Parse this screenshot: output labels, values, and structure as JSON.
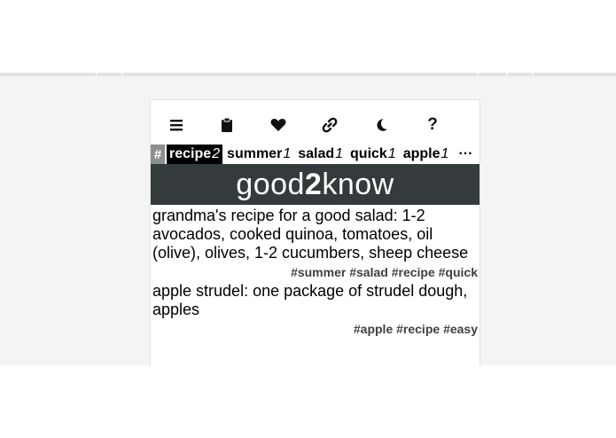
{
  "toolbar": {
    "buttons": [
      {
        "name": "menu-icon"
      },
      {
        "name": "clipboard-icon"
      },
      {
        "name": "heart-icon"
      },
      {
        "name": "link-icon"
      },
      {
        "name": "moon-icon"
      },
      {
        "name": "help-icon",
        "label": "?"
      }
    ]
  },
  "tags": {
    "hash_symbol": "#",
    "items": [
      {
        "label": "recipe",
        "count": "2",
        "active": true
      },
      {
        "label": "summer",
        "count": "1"
      },
      {
        "label": "salad",
        "count": "1"
      },
      {
        "label": "quick",
        "count": "1"
      },
      {
        "label": "apple",
        "count": "1"
      }
    ],
    "more": "···"
  },
  "brand": {
    "part1": "good",
    "part2": "2",
    "part3": "know"
  },
  "notes": [
    {
      "text": "grandma's recipe for a good salad: 1-2 avocados, cooked quinoa, tomatoes, oil (olive), olives, 1-2 cucumbers, sheep cheese",
      "tags": [
        "#summer",
        "#salad",
        "#recipe",
        "#quick"
      ]
    },
    {
      "text": "apple strudel: one package of strudel dough, apples",
      "tags": [
        "#apple",
        "#recipe",
        "#easy"
      ]
    }
  ],
  "colors": {
    "brand_bg": "#353b3d",
    "tag_active_bg": "#000000",
    "hash_bg": "#8a8f93"
  }
}
